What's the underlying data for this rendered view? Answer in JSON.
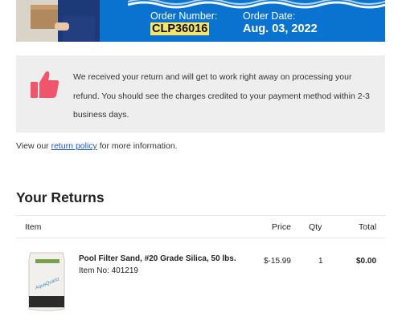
{
  "banner": {
    "order_number_label": "Order Number:",
    "order_number": "CLP36016",
    "order_date_label": "Order Date:",
    "order_date": "Aug. 03, 2022",
    "bg_color": "#0a73cf",
    "highlight_color": "#f5e66a"
  },
  "notice": {
    "icon": "thumbs-up-icon",
    "icon_color": "#f0566b",
    "message": "We received your return and will get to work right away on processing your refund. You should see the charges credited to your payment method within 2-3 business days."
  },
  "policy": {
    "prefix": "View our ",
    "link": "return policy",
    "suffix": " for more information."
  },
  "returns": {
    "title": "Your Returns",
    "columns": {
      "item": "Item",
      "price": "Price",
      "qty": "Qty",
      "total": "Total"
    },
    "items": [
      {
        "name": "Pool Filter Sand, #20 Grade Silica, 50 lbs.",
        "item_no": "Item No: 401219",
        "price": "$-15.99",
        "qty": "1",
        "total": "$0.00",
        "image_text": "AquaQuartz"
      }
    ]
  }
}
